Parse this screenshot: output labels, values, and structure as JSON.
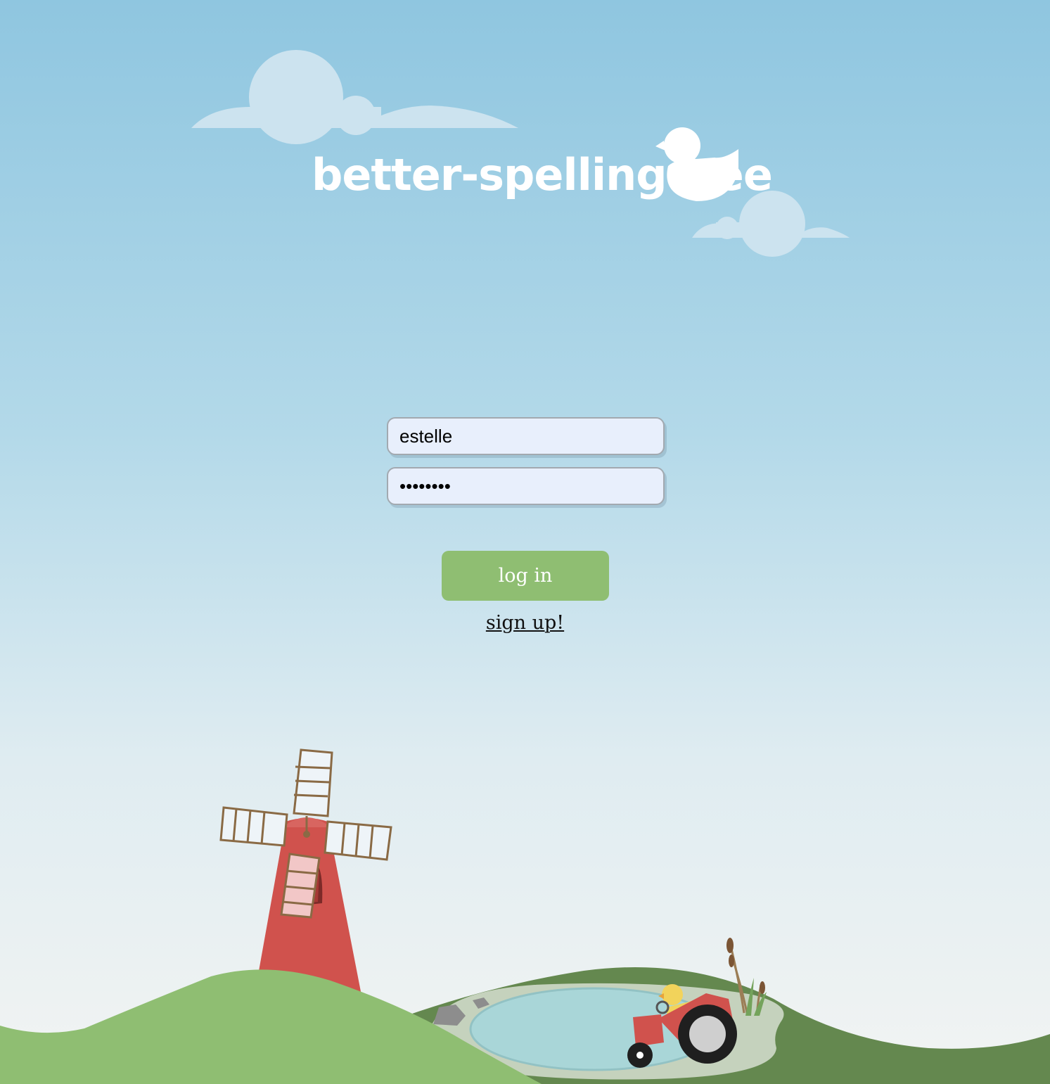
{
  "app": {
    "logo_text": "better-spelling-bee"
  },
  "login": {
    "username_value": "estelle",
    "password_value": "password",
    "login_label": "log in",
    "signup_label": "sign up!"
  },
  "colors": {
    "button": "#8fbe72",
    "input_bg": "#e8effc",
    "windmill": "#d0524d",
    "hill_light": "#8fbe72",
    "hill_dark": "#64884f",
    "pond": "#a9d6d8"
  },
  "icons": {
    "logo": "duck-icon",
    "scene": [
      "cloud-icon",
      "windmill-icon",
      "hill",
      "pond",
      "tractor-icon",
      "duck-icon",
      "cattail-icon"
    ]
  }
}
